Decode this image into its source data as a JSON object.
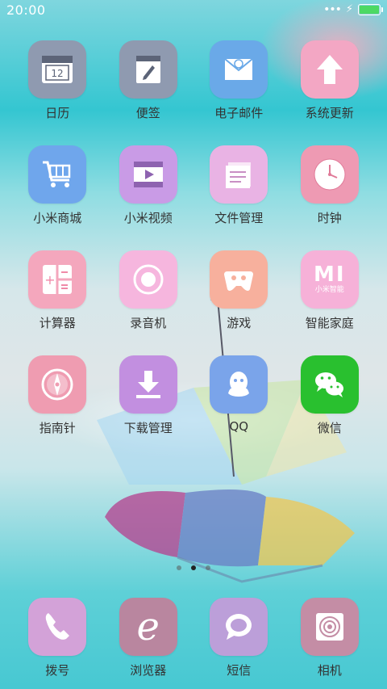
{
  "status": {
    "time": "20:00",
    "signal": "•••",
    "charging": "⚡",
    "battery_level": 1.0
  },
  "apps": [
    {
      "label": "日历",
      "icon": "calendar-icon",
      "badge": "12",
      "color": "#8f9ab0"
    },
    {
      "label": "便签",
      "icon": "notes-icon",
      "color": "#8f9ab0"
    },
    {
      "label": "电子邮件",
      "icon": "email-icon",
      "color": "#6aa9e8"
    },
    {
      "label": "系统更新",
      "icon": "update-icon",
      "color": "#f3a7c4"
    },
    {
      "label": "小米商城",
      "icon": "shopping-cart-icon",
      "color": "#6fa6ec"
    },
    {
      "label": "小米视频",
      "icon": "video-icon",
      "color": "#c99be6"
    },
    {
      "label": "文件管理",
      "icon": "folder-icon",
      "color": "#e9b3e4"
    },
    {
      "label": "时钟",
      "icon": "clock-icon",
      "color": "#ee9ab3"
    },
    {
      "label": "计算器",
      "icon": "calculator-icon",
      "color": "#f4a7bd"
    },
    {
      "label": "录音机",
      "icon": "recorder-icon",
      "color": "#f6b6de"
    },
    {
      "label": "游戏",
      "icon": "game-icon",
      "color": "#f7b09d"
    },
    {
      "label": "智能家庭",
      "icon": "smart-home-icon",
      "text": "MI",
      "subtext": "小米智能",
      "color": "#f6b1d8"
    },
    {
      "label": "指南针",
      "icon": "compass-icon",
      "color": "#ef9cb1"
    },
    {
      "label": "下载管理",
      "icon": "download-icon",
      "color": "#c28fe0"
    },
    {
      "label": "QQ",
      "icon": "qq-icon",
      "color": "#7aa4ea"
    },
    {
      "label": "微信",
      "icon": "wechat-icon",
      "color": "#29c02f"
    }
  ],
  "dock": [
    {
      "label": "拨号",
      "icon": "phone-icon",
      "color": "#d3a2d8"
    },
    {
      "label": "浏览器",
      "icon": "browser-icon",
      "color": "#b9869f"
    },
    {
      "label": "短信",
      "icon": "message-icon",
      "color": "#bc9fd9"
    },
    {
      "label": "相机",
      "icon": "camera-icon",
      "color": "#c48da5"
    }
  ],
  "pager": {
    "pages": 3,
    "active": 2
  }
}
